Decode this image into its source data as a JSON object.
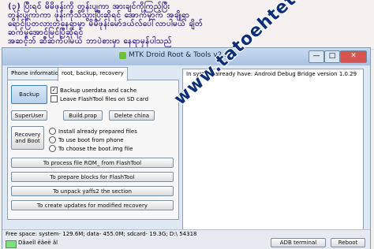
{
  "banner": {
    "lines": [
      "(၃) ပြီးရင် မိမိဖုန်းကို တွန်းပျကာ အားချင်ကိုကြည့်ပြီး",
      "တွန်းပျကာကာ ဖုန်းကိုသိသွားပြီးဆိုရင် အောက်မှာက အချိုရာ",
      "ရောင်ပြတလားတဲ့နေရာမှာ မိမိဖုန်းမော်ဒယ်လ်ပေါ်လာပါမယ် ချိတ်",
      "ဆက်မှုအောင်မြင်ပြီဆိုရင်",
      "  အဆင့်ဘ် ဆီဆက်ပါမယ် ဘာပဲစားမှာ နေရာမှန်ပါသည်"
    ]
  },
  "window": {
    "title": "MTK Droid Root & Tools v2.3.4",
    "controls": [
      "—",
      "□",
      "✕"
    ]
  },
  "tabs": [
    "Phone information",
    "root, backup, recovery"
  ],
  "buttons": {
    "backup": "Backup",
    "superuser": "SuperUser",
    "buildprop": "Build.prop",
    "delete_china": "Delete china",
    "recovery_boot": "Recovery\nand Boot",
    "process_rom": "To process file  ROM_  from  FlashTool",
    "prepare_blocks": "To prepare blocks for FlashTool",
    "unpack_yaffs2": "To unpack yaffs2 the section",
    "create_updates": "To create updates for modified recovery",
    "adb_terminal": "ADB terminal",
    "reboot": "Reboot"
  },
  "checkboxes": [
    {
      "label": "Backup userdata and cache",
      "checked": true
    },
    {
      "label": "Leave FlashTool files on SD card",
      "checked": false
    }
  ],
  "radios": [
    {
      "label": "Install already prepared files"
    },
    {
      "label": "To use boot from phone"
    },
    {
      "label": "To choose the boot.img file"
    }
  ],
  "log": {
    "text": "In system already have:  Android Debug Bridge version 1.0.29"
  },
  "status": {
    "free_space": "Free space: system- 129.6M; data- 455.0M; sdcard- 19.3G;  D:\\ 54318",
    "label": "Dâaeîl ëâeë âl"
  },
  "watermark": "www.tatoehtet.net/",
  "colors": {
    "banner_text": "#3b2a8a",
    "watermark": "#0d2f7a",
    "progress": "#7fe07f"
  },
  "icons": {
    "window": "android-icon"
  }
}
